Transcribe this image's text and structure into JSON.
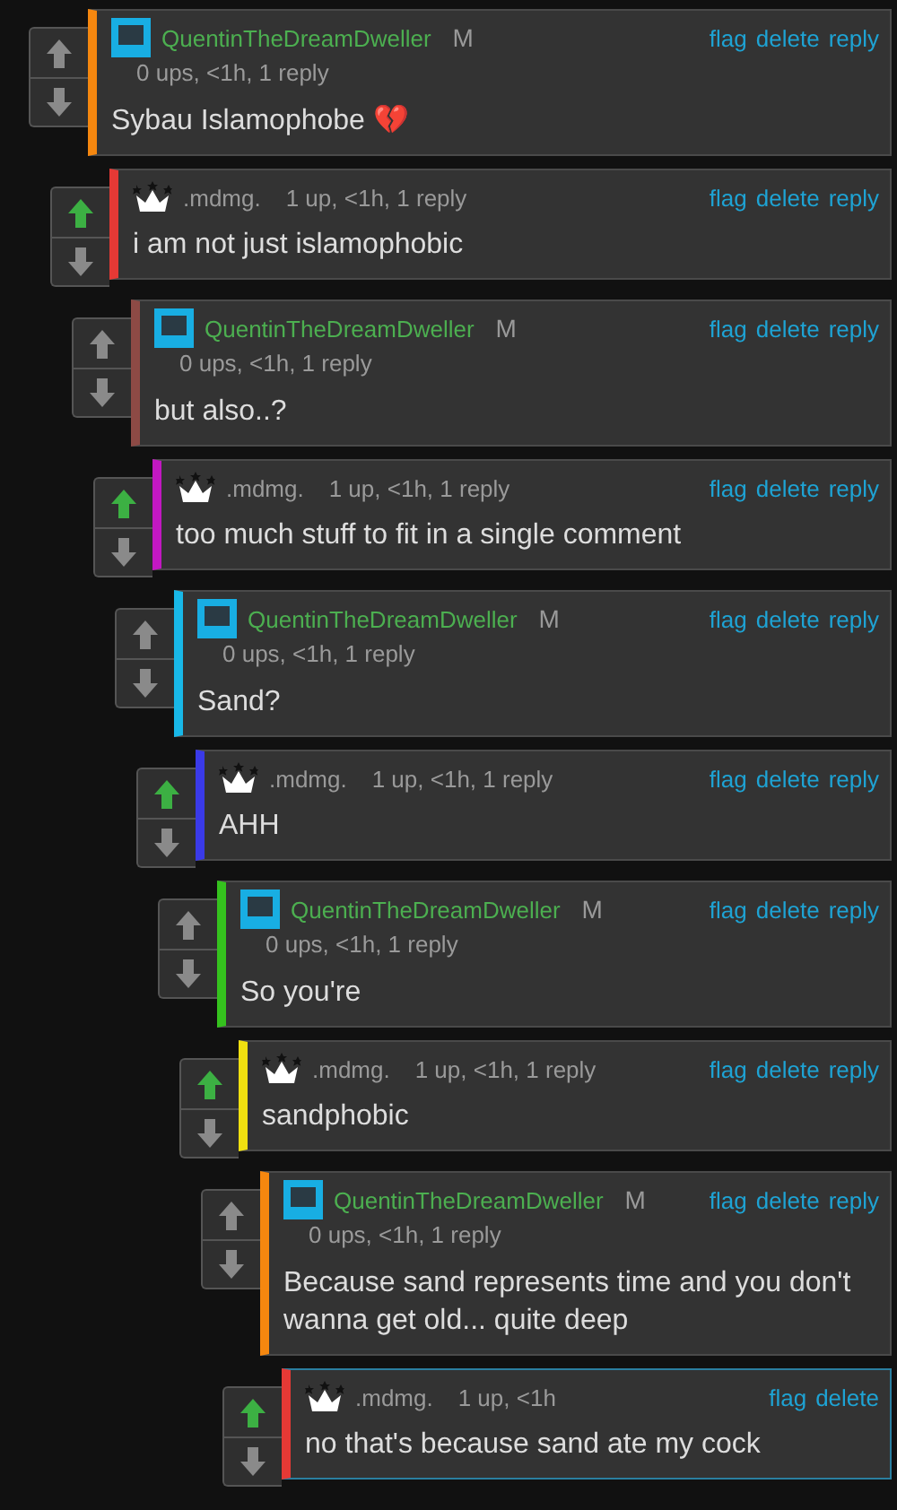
{
  "comments": [
    {
      "kind": "mod",
      "author": "QuentinTheDreamDweller",
      "badge": "M",
      "meta": "0 ups, <1h, 1 reply",
      "upvoted": false,
      "color": "#f5870f",
      "highlighted": false,
      "text": "Sybau Islamophobe 💔",
      "actions": [
        "flag",
        "delete",
        "reply"
      ],
      "children": [
        {
          "kind": "crown",
          "author": ".mdmg.",
          "meta": "1 up, <1h, 1 reply",
          "upvoted": true,
          "color": "#e53935",
          "highlighted": false,
          "text": "i am not just islamophobic",
          "actions": [
            "flag",
            "delete",
            "reply"
          ],
          "children": [
            {
              "kind": "mod",
              "author": "QuentinTheDreamDweller",
              "badge": "M",
              "meta": "0 ups, <1h, 1 reply",
              "upvoted": false,
              "color": "#8d4a45",
              "highlighted": false,
              "text": "but also..?",
              "actions": [
                "flag",
                "delete",
                "reply"
              ],
              "children": [
                {
                  "kind": "crown",
                  "author": ".mdmg.",
                  "meta": "1 up, <1h, 1 reply",
                  "upvoted": true,
                  "color": "#c218c2",
                  "highlighted": false,
                  "text": "too much stuff to fit in a single comment",
                  "actions": [
                    "flag",
                    "delete",
                    "reply"
                  ],
                  "children": [
                    {
                      "kind": "mod",
                      "author": "QuentinTheDreamDweller",
                      "badge": "M",
                      "meta": "0 ups, <1h, 1 reply",
                      "upvoted": false,
                      "color": "#18b8e8",
                      "highlighted": false,
                      "text": "Sand?",
                      "actions": [
                        "flag",
                        "delete",
                        "reply"
                      ],
                      "children": [
                        {
                          "kind": "crown",
                          "author": ".mdmg.",
                          "meta": "1 up, <1h, 1 reply",
                          "upvoted": true,
                          "color": "#3a3ae8",
                          "highlighted": false,
                          "text": "AHH",
                          "actions": [
                            "flag",
                            "delete",
                            "reply"
                          ],
                          "children": [
                            {
                              "kind": "mod",
                              "author": "QuentinTheDreamDweller",
                              "badge": "M",
                              "meta": "0 ups, <1h, 1 reply",
                              "upvoted": false,
                              "color": "#35c21e",
                              "highlighted": false,
                              "text": "So you're",
                              "actions": [
                                "flag",
                                "delete",
                                "reply"
                              ],
                              "children": [
                                {
                                  "kind": "crown",
                                  "author": ".mdmg.",
                                  "meta": "1 up, <1h, 1 reply",
                                  "upvoted": true,
                                  "color": "#f0e010",
                                  "highlighted": false,
                                  "text": "sandphobic",
                                  "actions": [
                                    "flag",
                                    "delete",
                                    "reply"
                                  ],
                                  "children": [
                                    {
                                      "kind": "mod",
                                      "author": "QuentinTheDreamDweller",
                                      "badge": "M",
                                      "meta": "0 ups, <1h, 1 reply",
                                      "upvoted": false,
                                      "color": "#f5870f",
                                      "highlighted": false,
                                      "text": "Because sand represents time and you don't wanna get old... quite deep",
                                      "actions": [
                                        "flag",
                                        "delete",
                                        "reply"
                                      ],
                                      "children": [
                                        {
                                          "kind": "crown",
                                          "author": ".mdmg.",
                                          "meta": "1 up, <1h",
                                          "upvoted": true,
                                          "color": "#e53935",
                                          "highlighted": true,
                                          "text": "no that's because sand ate my cock",
                                          "actions": [
                                            "flag",
                                            "delete"
                                          ]
                                        }
                                      ]
                                    }
                                  ]
                                }
                              ]
                            }
                          ]
                        }
                      ]
                    }
                  ]
                }
              ]
            }
          ]
        }
      ]
    }
  ]
}
